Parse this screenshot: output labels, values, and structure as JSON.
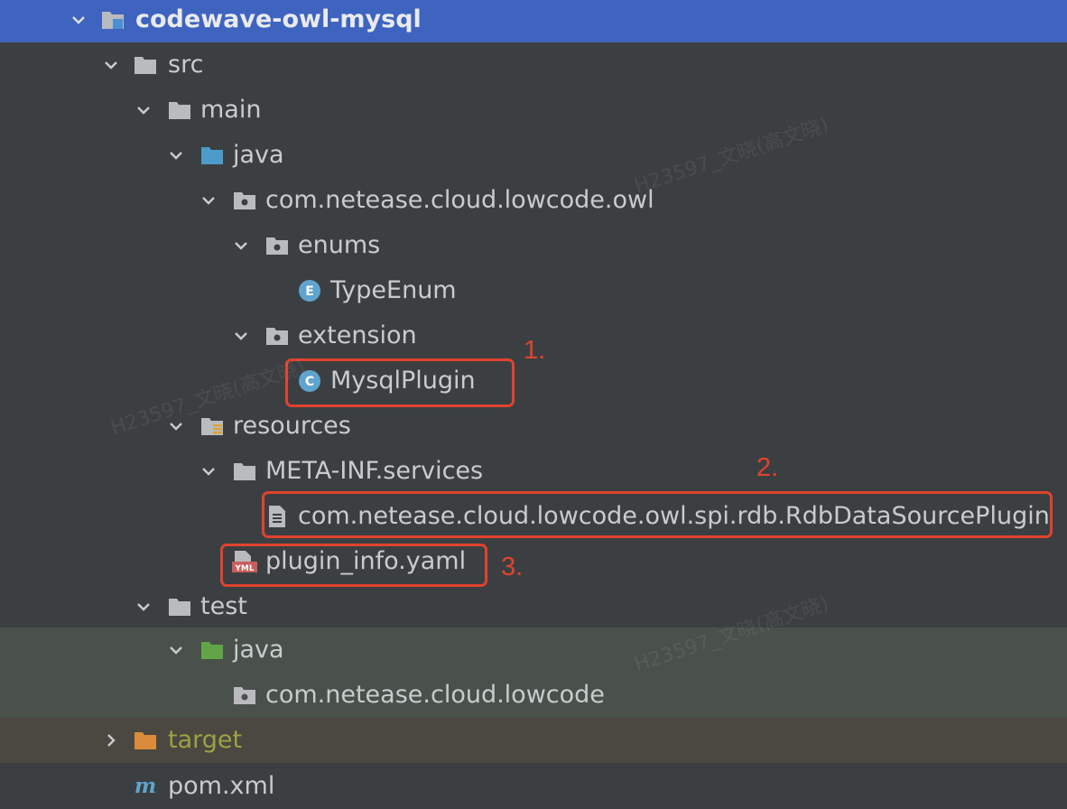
{
  "tree": {
    "items": [
      {
        "label": "codewave-owl-mysql",
        "icon": "module-folder-icon"
      },
      {
        "label": "src",
        "icon": "folder-icon"
      },
      {
        "label": "main",
        "icon": "folder-icon"
      },
      {
        "label": "java",
        "icon": "source-root-folder-icon"
      },
      {
        "label": "com.netease.cloud.lowcode.owl",
        "icon": "package-icon"
      },
      {
        "label": "enums",
        "icon": "package-icon"
      },
      {
        "label": "TypeEnum",
        "icon": "enum-class-icon",
        "badge": "E"
      },
      {
        "label": "extension",
        "icon": "package-icon"
      },
      {
        "label": "MysqlPlugin",
        "icon": "java-class-icon",
        "badge": "C"
      },
      {
        "label": "resources",
        "icon": "resources-folder-icon"
      },
      {
        "label": "META-INF.services",
        "icon": "folder-icon"
      },
      {
        "label": "com.netease.cloud.lowcode.owl.spi.rdb.RdbDataSourcePlugin",
        "icon": "text-file-icon"
      },
      {
        "label": "plugin_info.yaml",
        "icon": "yaml-file-icon",
        "badge": "YML"
      },
      {
        "label": "test",
        "icon": "folder-icon"
      },
      {
        "label": "java",
        "icon": "test-source-folder-icon"
      },
      {
        "label": "com.netease.cloud.lowcode",
        "icon": "package-icon"
      },
      {
        "label": "target",
        "icon": "excluded-folder-icon"
      },
      {
        "label": "pom.xml",
        "icon": "maven-file-icon",
        "badge": "m"
      }
    ]
  },
  "annotations": {
    "one": "1.",
    "two": "2.",
    "three": "3."
  },
  "watermark": "H23597_文晓(高文晓)",
  "colors": {
    "selection": "#3e64c0",
    "background": "#3c3f41",
    "highlight": "#e0432f",
    "test_band": "#49514a",
    "target_text": "#a0a044"
  }
}
